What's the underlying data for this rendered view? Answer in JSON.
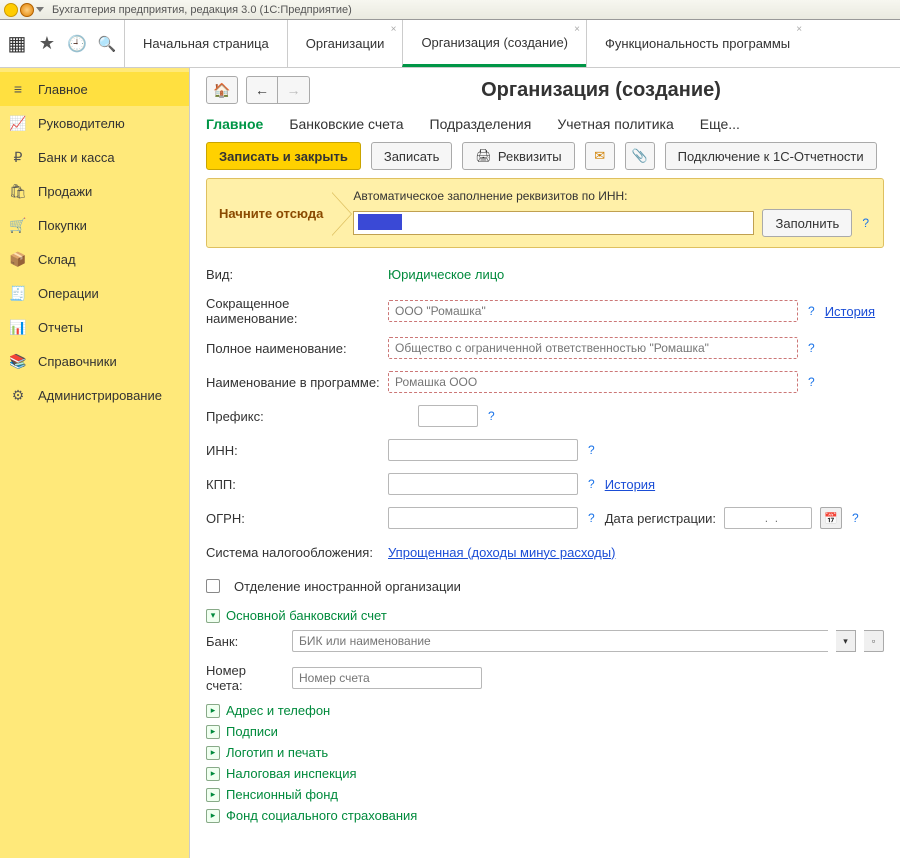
{
  "window": {
    "title": "Бухгалтерия предприятия, редакция 3.0  (1С:Предприятие)"
  },
  "tabs": {
    "t0": "Начальная страница",
    "t1": "Организации",
    "t2": "Организация (создание)",
    "t3": "Функциональность программы"
  },
  "sidebar": {
    "items": {
      "main": "Главное",
      "manager": "Руководителю",
      "bank": "Банк и касса",
      "sales": "Продажи",
      "purch": "Покупки",
      "stock": "Склад",
      "ops": "Операции",
      "reports": "Отчеты",
      "refs": "Справочники",
      "admin": "Администрирование"
    }
  },
  "page": {
    "title": "Организация (создание)"
  },
  "sectTabs": {
    "s0": "Главное",
    "s1": "Банковские счета",
    "s2": "Подразделения",
    "s3": "Учетная политика",
    "s4": "Еще..."
  },
  "actions": {
    "saveClose": "Записать и закрыть",
    "save": "Записать",
    "requis": "Реквизиты",
    "connect": "Подключение к 1С-Отчетности"
  },
  "start": {
    "heading": "Начните отсюда",
    "caption": "Автоматическое заполнение реквизитов по ИНН:",
    "fillBtn": "Заполнить"
  },
  "form": {
    "vid_l": "Вид:",
    "vid_v": "Юридическое лицо",
    "short_l": "Сокращенное наименование:",
    "short_ph": "ООО \"Ромашка\"",
    "full_l": "Полное наименование:",
    "full_ph": "Общество с ограниченной ответственностью \"Ромашка\"",
    "prog_l": "Наименование в программе:",
    "prog_ph": "Ромашка ООО",
    "prefix_l": "Префикс:",
    "inn_l": "ИНН:",
    "kpp_l": "КПП:",
    "ogrn_l": "ОГРН:",
    "regdate_l": "Дата регистрации:",
    "regdate_ph": "  .  .",
    "tax_l": "Система налогообложения:",
    "tax_link": "Упрощенная (доходы минус расходы)",
    "foreign_chk": "Отделение иностранной организации",
    "history_link": "История",
    "bankGroup": "Основной банковский счет",
    "bank_l": "Банк:",
    "bank_ph": "БИК или наименование",
    "acct_l": "Номер счета:",
    "acct_ph": "Номер счета"
  },
  "groups": {
    "g1": "Адрес и телефон",
    "g2": "Подписи",
    "g3": "Логотип и печать",
    "g4": "Налоговая инспекция",
    "g5": "Пенсионный фонд",
    "g6": "Фонд социального страхования"
  },
  "misc": {
    "q": "?"
  }
}
